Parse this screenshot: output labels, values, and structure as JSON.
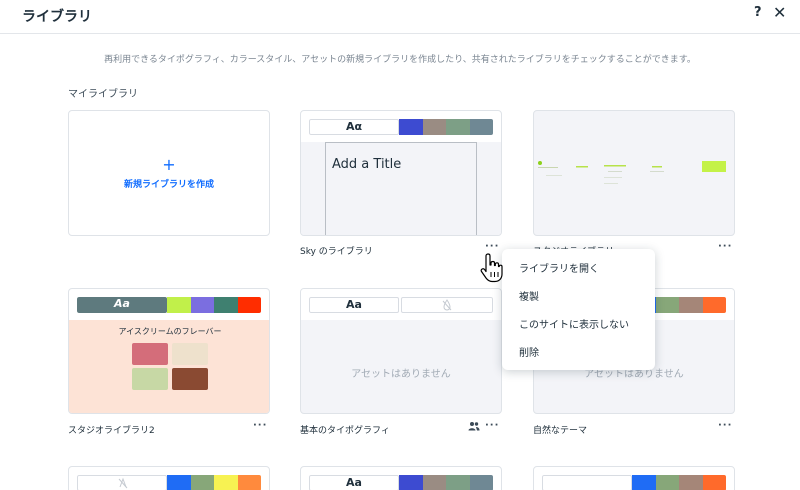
{
  "header": {
    "title": "ライブラリ",
    "help_label": "?",
    "close_label": "✕"
  },
  "description": "再利用できるタイポグラフィ、カラースタイル、アセットの新規ライブラリを作成したり、共有されたライブラリをチェックすることができます。",
  "section_label": "マイライブラリ",
  "create": {
    "plus": "+",
    "label": "新規ライブラリを作成"
  },
  "more_label": "···",
  "cards": [
    {
      "name": "Sky のライブラリ",
      "aa": "Aα",
      "swatches": [
        "#3d4bd1",
        "#9a8c83",
        "#7d9f86",
        "#6f8894"
      ],
      "preview_title": "Add a Title"
    },
    {
      "name": "スタジオライブラリ"
    },
    {
      "name": "スタジオライブラリ2",
      "aa": "Aa",
      "swatches": [
        "#c1f04a",
        "#7b6ee0",
        "#3f8070",
        "#ff2d00"
      ],
      "preview_title": "アイスクリームのフレーバー"
    },
    {
      "name": "基本のタイポグラフィ",
      "aa": "Aa",
      "empty": "アセットはありません"
    },
    {
      "name": "自然なテーマ",
      "swatches": [
        "#1f6cf5",
        "#87a779",
        "#a58678",
        "#ff6a2b"
      ],
      "empty": "アセットはありません"
    },
    {
      "swatches": [
        "#1f6cf5",
        "#87a779",
        "#f7f252",
        "#ff8a3d"
      ]
    },
    {
      "aa": "Aa",
      "swatches": [
        "#3d4bd1",
        "#9a8c83",
        "#7d9f86",
        "#6f8894"
      ]
    },
    {
      "swatches": [
        "#1f6cf5",
        "#87a779",
        "#a58678",
        "#ff6a2b"
      ]
    }
  ],
  "context_menu": {
    "items": [
      "ライブラリを開く",
      "複製",
      "このサイトに表示しない",
      "削除"
    ]
  },
  "icons": {
    "shared": "people-icon",
    "cursor": "hand-pointer-icon",
    "add": "plus-icon"
  }
}
